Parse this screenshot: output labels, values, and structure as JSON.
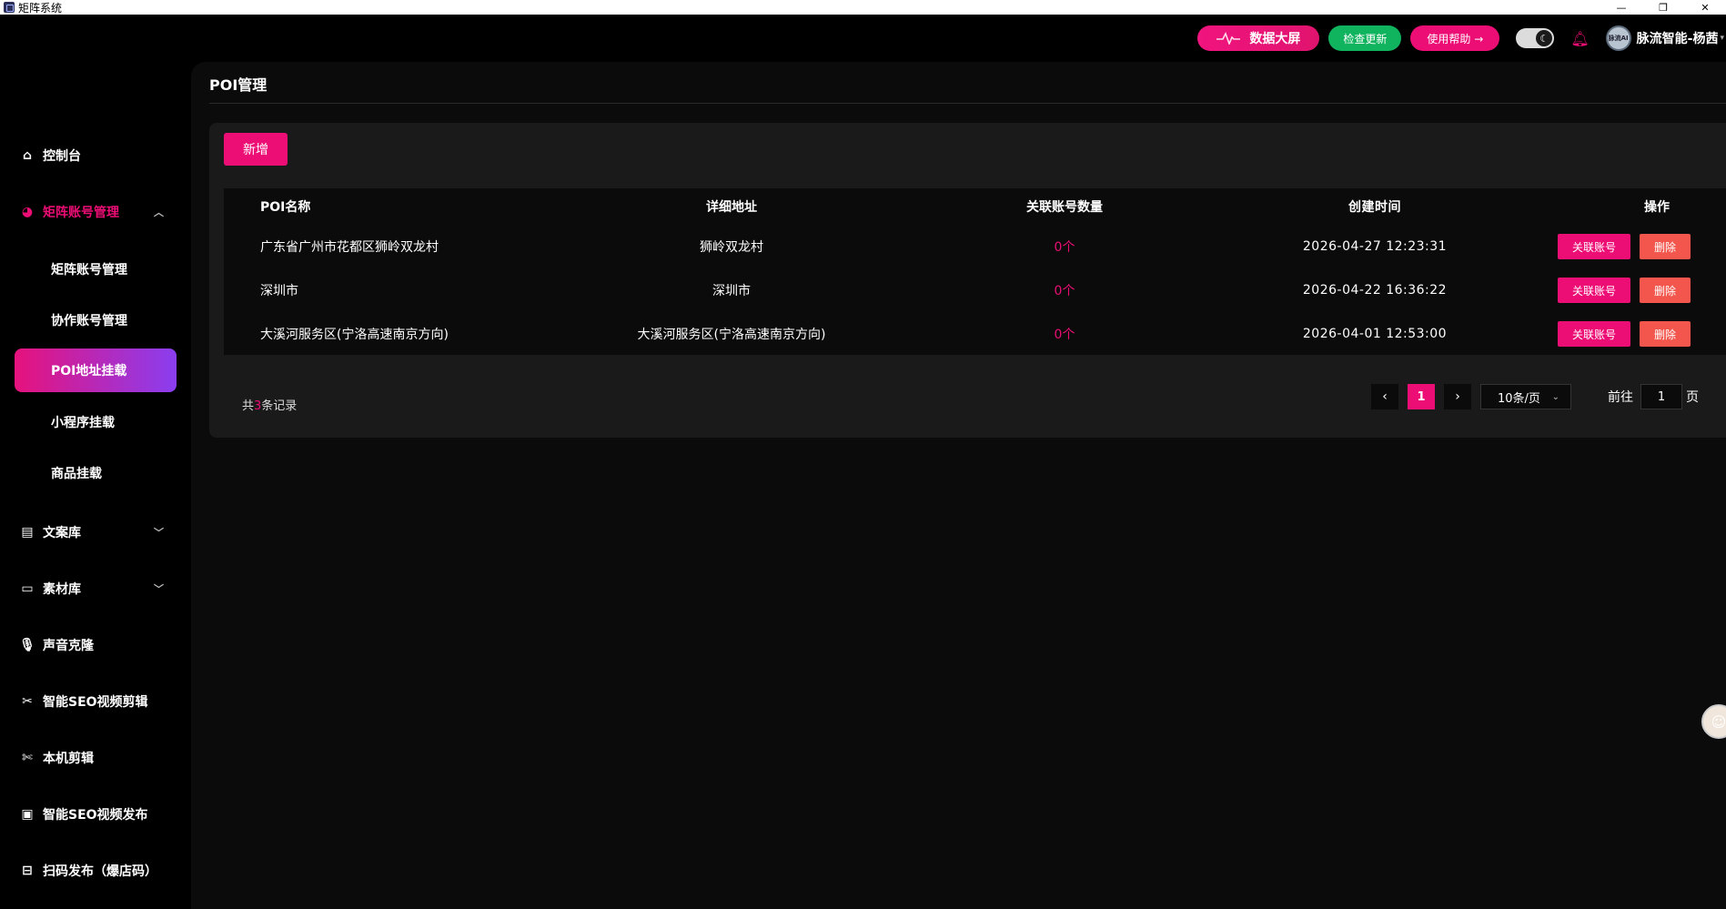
{
  "window": {
    "title": "矩阵系统",
    "minimize": "—",
    "maximize": "❐",
    "close": "✕"
  },
  "header": {
    "screen_btn": "数据大屏",
    "update_btn": "检查更新",
    "help_btn": "使用帮助 →",
    "avatar_text": "脉流AI",
    "username": "脉流智能-杨茜",
    "icons": [
      "pulse-icon",
      "moon-icon",
      "bell-icon",
      "user-avatar"
    ]
  },
  "sidebar": {
    "items": [
      {
        "label": "控制台",
        "icon": "home-icon"
      },
      {
        "label": "矩阵账号管理",
        "icon": "matrix-icon"
      },
      {
        "label": "矩阵账号管理",
        "icon": ""
      },
      {
        "label": "协作账号管理",
        "icon": ""
      },
      {
        "label": "POI地址挂载",
        "icon": ""
      },
      {
        "label": "小程序挂载",
        "icon": ""
      },
      {
        "label": "商品挂载",
        "icon": ""
      },
      {
        "label": "文案库",
        "icon": "table-icon"
      },
      {
        "label": "素材库",
        "icon": "folder-icon"
      },
      {
        "label": "声音克隆",
        "icon": "mic-icon"
      },
      {
        "label": "智能SEO视频剪辑",
        "icon": "scissors-icon"
      },
      {
        "label": "本机剪辑",
        "icon": "scissors-icon"
      },
      {
        "label": "智能SEO视频发布",
        "icon": "video-icon"
      },
      {
        "label": "扫码发布（爆店码）",
        "icon": "qr-icon"
      }
    ]
  },
  "main": {
    "title": "POI管理",
    "add_btn": "新增",
    "table": {
      "headers": [
        "POI名称",
        "详细地址",
        "关联账号数量",
        "创建时间",
        "操作"
      ],
      "rows": [
        {
          "name": "广东省广州市花都区狮岭双龙村",
          "address": "狮岭双龙村",
          "count": "0个",
          "created": "2026-04-27 12:23:31"
        },
        {
          "name": "深圳市",
          "address": "深圳市",
          "count": "0个",
          "created": "2026-04-22 16:36:22"
        },
        {
          "name": "大溪河服务区(宁洛高速南京方向)",
          "address": "大溪河服务区(宁洛高速南京方向)",
          "count": "0个",
          "created": "2026-04-01 12:53:00"
        }
      ],
      "link_btn": "关联账号",
      "delete_btn": "删除"
    },
    "pagination": {
      "total_prefix": "共",
      "total": "3",
      "total_suffix": "条记录",
      "prev": "‹",
      "current": "1",
      "next": "›",
      "page_size": "10条/页",
      "goto_prefix": "前往",
      "goto_value": "1",
      "goto_suffix": "页"
    }
  },
  "colors": {
    "accent": "#ec0d75",
    "success": "#10b35e",
    "danger": "#f2564c",
    "active_gradient_end": "#8a3ef0"
  }
}
